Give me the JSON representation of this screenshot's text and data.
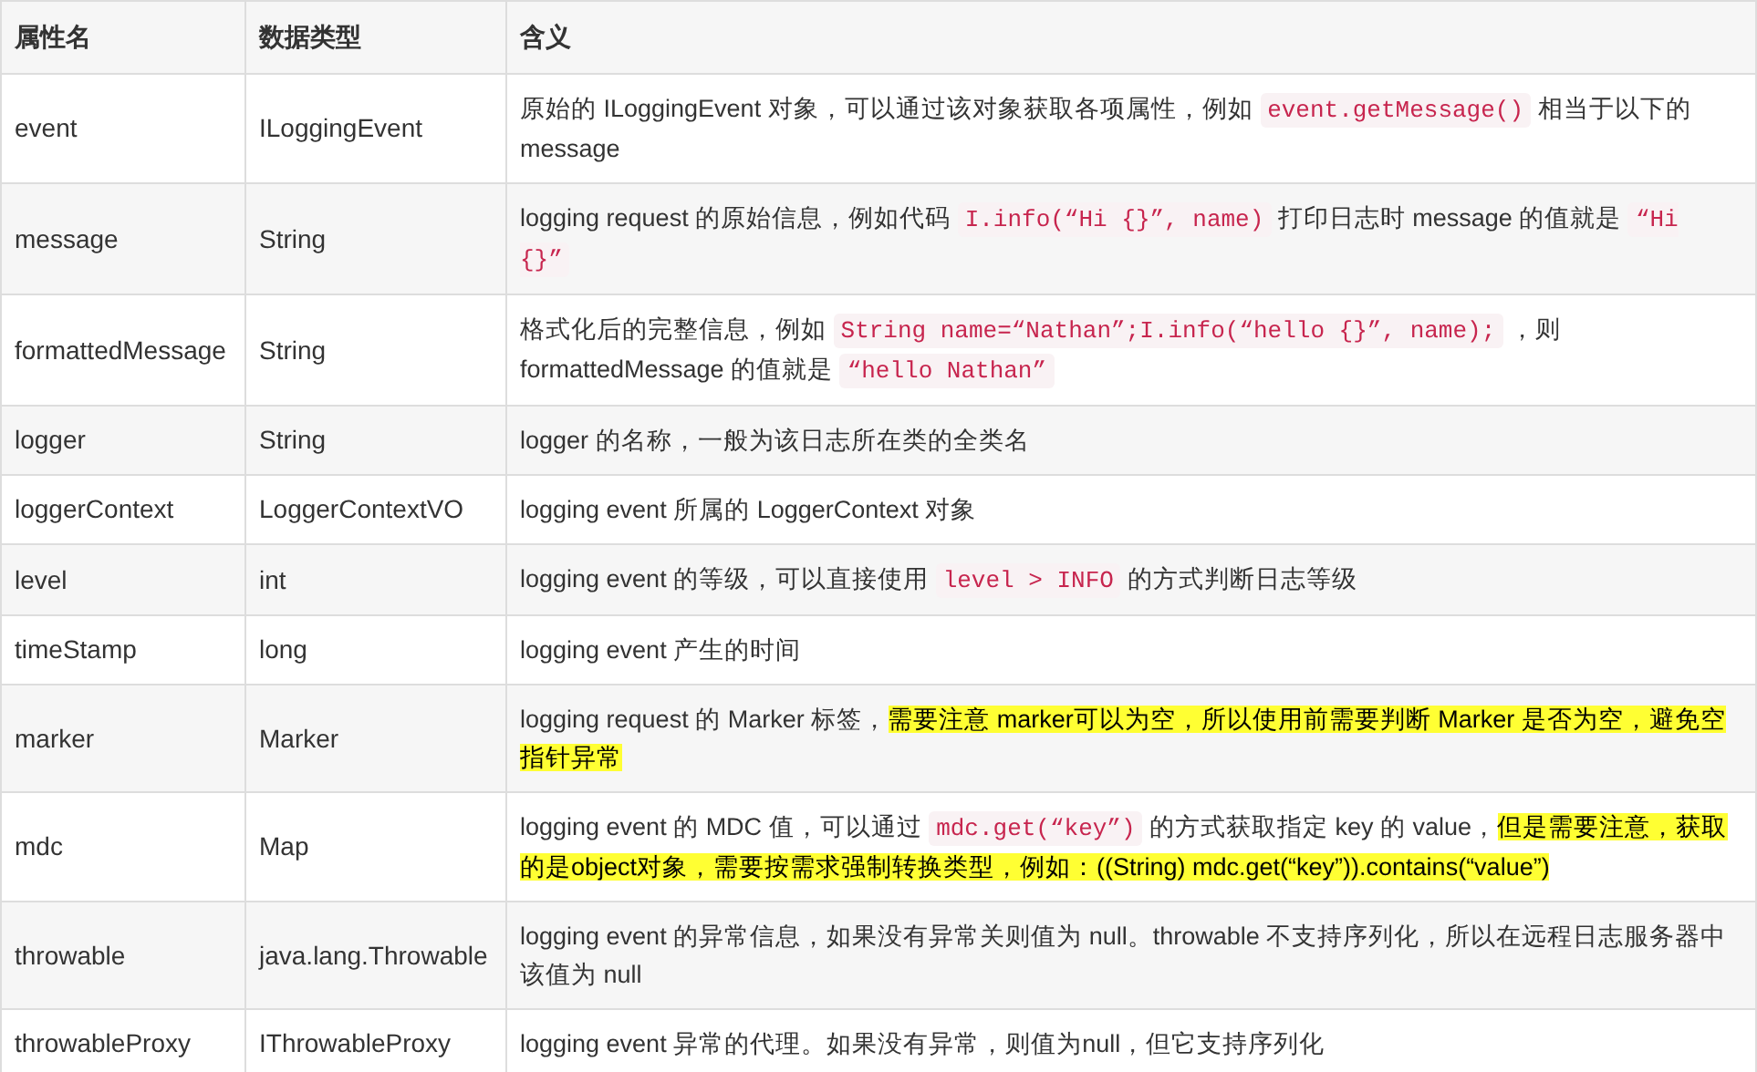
{
  "table": {
    "columns": [
      "属性名",
      "数据类型",
      "含义"
    ],
    "rows": [
      {
        "name": "event",
        "type": "ILoggingEvent",
        "meaning": [
          {
            "kind": "text",
            "text": "原始的 ILoggingEvent 对象，可以通过该对象获取各项属性，例如 "
          },
          {
            "kind": "code",
            "text": "event.getMessage()"
          },
          {
            "kind": "text",
            "text": " 相当于以下的 message"
          }
        ]
      },
      {
        "name": "message",
        "type": "String",
        "meaning": [
          {
            "kind": "text",
            "text": "logging request 的原始信息，例如代码 "
          },
          {
            "kind": "code",
            "text": "I.info(“Hi {}”, name)"
          },
          {
            "kind": "text",
            "text": " 打印日志时 message 的值就是 "
          },
          {
            "kind": "code",
            "text": "“Hi {}”"
          }
        ]
      },
      {
        "name": "formattedMessage",
        "type": "String",
        "meaning": [
          {
            "kind": "text",
            "text": "格式化后的完整信息，例如 "
          },
          {
            "kind": "code",
            "text": "String name=“Nathan”;I.info(“hello {}”, name);"
          },
          {
            "kind": "text",
            "text": " ，则 formattedMessage 的值就是 "
          },
          {
            "kind": "code",
            "text": "“hello Nathan”"
          }
        ]
      },
      {
        "name": "logger",
        "type": "String",
        "meaning": [
          {
            "kind": "text",
            "text": "logger 的名称，一般为该日志所在类的全类名"
          }
        ]
      },
      {
        "name": "loggerContext",
        "type": "LoggerContextVO",
        "meaning": [
          {
            "kind": "text",
            "text": "logging event 所属的 LoggerContext 对象"
          }
        ]
      },
      {
        "name": "level",
        "type": "int",
        "meaning": [
          {
            "kind": "text",
            "text": "logging event 的等级，可以直接使用 "
          },
          {
            "kind": "code",
            "text": "level > INFO"
          },
          {
            "kind": "text",
            "text": " 的方式判断日志等级"
          }
        ]
      },
      {
        "name": "timeStamp",
        "type": "long",
        "meaning": [
          {
            "kind": "text",
            "text": "logging event 产生的时间"
          }
        ]
      },
      {
        "name": "marker",
        "type": "Marker",
        "meaning": [
          {
            "kind": "text",
            "text": "logging request 的 Marker 标签，"
          },
          {
            "kind": "highlight",
            "text": "需要注意 marker可以为空，所以使用前需要判断 Marker 是否为空，避免空指针异常"
          }
        ]
      },
      {
        "name": "mdc",
        "type": "Map",
        "meaning": [
          {
            "kind": "text",
            "text": "logging event 的 MDC 值，可以通过 "
          },
          {
            "kind": "code",
            "text": "mdc.get(“key”)"
          },
          {
            "kind": "text",
            "text": " 的方式获取指定 key 的 value，"
          },
          {
            "kind": "highlight",
            "text": "但是需要注意，获取的是object对象，需要按需求强制转换类型，例如：((String) mdc.get(“key”)).contains(“value”)"
          }
        ]
      },
      {
        "name": "throwable",
        "type": "java.lang.Throwable",
        "meaning": [
          {
            "kind": "text",
            "text": "logging event 的异常信息，如果没有异常关则值为 null。throwable 不支持序列化，所以在远程日志服务器中该值为 null"
          }
        ]
      },
      {
        "name": "throwableProxy",
        "type": "IThrowableProxy",
        "meaning": [
          {
            "kind": "text",
            "text": "logging event 异常的代理。如果没有异常，则值为null，但它支持序列化"
          }
        ]
      }
    ]
  }
}
